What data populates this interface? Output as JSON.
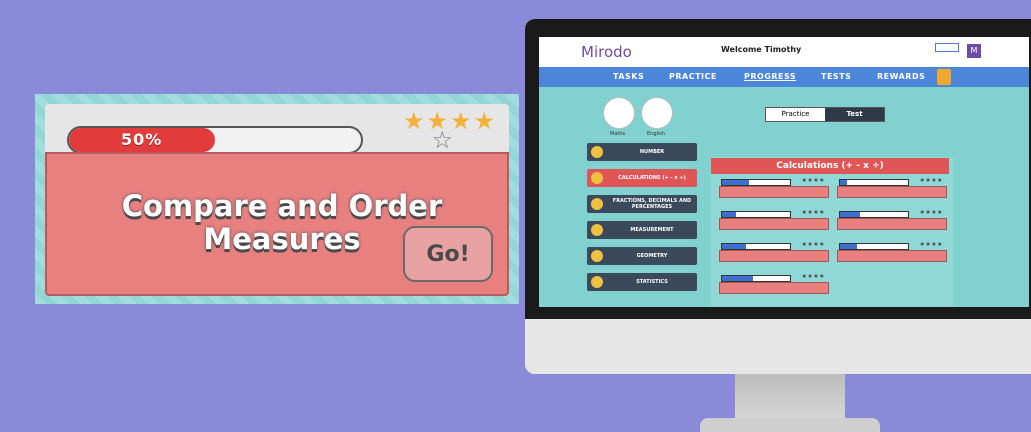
{
  "card": {
    "progress_label": "50%",
    "progress_fraction": 0.5,
    "stars_filled": 4,
    "stars_total": 5,
    "title_line1": "Compare and Order",
    "title_line2": "Measures",
    "go_label": "Go!"
  },
  "app": {
    "logo": "Mirodo",
    "welcome": "Welcome Timothy",
    "avatar_letter": "M",
    "nav": [
      "TASKS",
      "PRACTICE",
      "PROGRESS",
      "TESTS",
      "REWARDS"
    ],
    "subjects": [
      "Maths",
      "English"
    ],
    "toggle": [
      "Practice",
      "Test"
    ],
    "sidebar": [
      "NUMBER",
      "CALCULATIONS (+ - x ÷)",
      "FRACTIONS, DECIMALS AND PERCENTAGES",
      "MEASUREMENT",
      "GEOMETRY",
      "STATISTICS"
    ],
    "panel_title": "Calculations (+ - x ÷)"
  },
  "colors": {
    "background": "#8a8bd8",
    "card_pink": "#e88080",
    "progress_red": "#e23b3b",
    "star_gold": "#f2b23a",
    "nav_blue": "#4c86d9",
    "screen_teal": "#80d1d0"
  },
  "icons": [
    "star-icon",
    "laptop-icon",
    "globe-icon",
    "avatar-icon"
  ]
}
